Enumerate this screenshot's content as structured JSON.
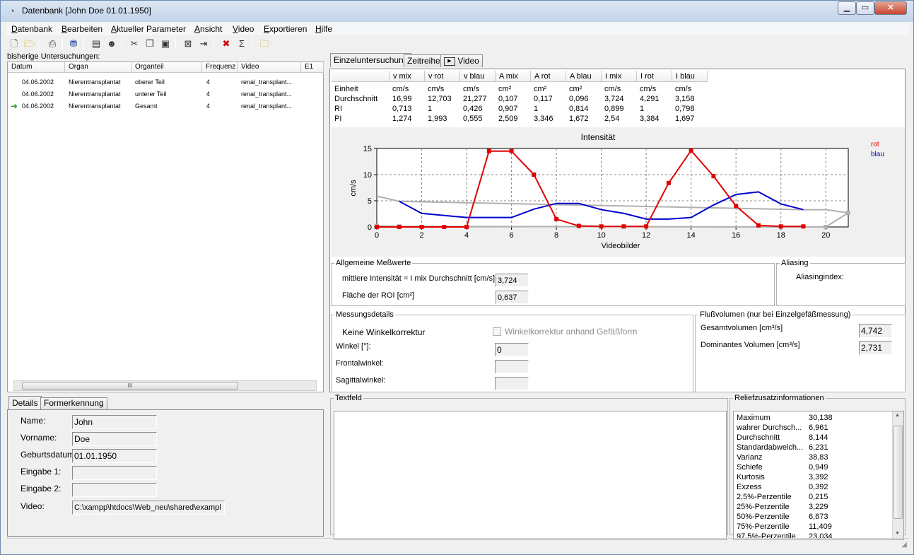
{
  "window": {
    "title": "Datenbank [John Doe 01.01.1950]",
    "min_glyph": "▁",
    "max_glyph": "▭",
    "close_glyph": "✕"
  },
  "menubar": {
    "items": [
      {
        "first": "D",
        "rest": "atenbank"
      },
      {
        "first": "B",
        "rest": "earbeiten"
      },
      {
        "first": "A",
        "rest": "ktueller Parameter"
      },
      {
        "first": "A",
        "rest": "nsicht"
      },
      {
        "first": "V",
        "rest": "ideo"
      },
      {
        "first": "E",
        "rest": "xportieren"
      },
      {
        "first": "H",
        "rest": "ilfe"
      }
    ]
  },
  "toolbar": {
    "icons": [
      "new-file-icon",
      "open-folder-icon",
      "print-icon",
      "filter-icon",
      "book-icon",
      "user-icon",
      "cut-icon",
      "copy-icon",
      "paste-icon",
      "box-icon",
      "exit-icon",
      "delete-icon",
      "sum-icon",
      "folder-icon"
    ]
  },
  "left": {
    "label": "bisherige Untersuchungen:",
    "columns": [
      "Datum",
      "Organ",
      "Organteil",
      "Frequenz",
      "Video",
      "E1"
    ],
    "rows": [
      {
        "datum": "04.06.2002",
        "organ": "Nierentransplantat",
        "organteil": "oberer Teil",
        "frequenz": "4",
        "video": "renal_transplant...",
        "marker": ""
      },
      {
        "datum": "04.06.2002",
        "organ": "Nierentransplantat",
        "organteil": "unterer Teil",
        "frequenz": "4",
        "video": "renal_transplant...",
        "marker": ""
      },
      {
        "datum": "04.06.2002",
        "organ": "Nierentransplantat",
        "organteil": "Gesamt",
        "frequenz": "4",
        "video": "renal_transplant...",
        "marker": "➜"
      }
    ],
    "scroll_grip": "III"
  },
  "details": {
    "tabs": [
      "Details",
      "Formerkennung"
    ],
    "fields": [
      {
        "label": "Name:",
        "value": "John"
      },
      {
        "label": "Vorname:",
        "value": "Doe"
      },
      {
        "label": "Geburtsdatum:",
        "value": "01.01.1950"
      },
      {
        "label": "Eingabe 1:",
        "value": ""
      },
      {
        "label": "Eingabe 2:",
        "value": ""
      },
      {
        "label": "Video:",
        "value": "C:\\xampp\\htdocs\\Web_neu\\shared\\exampl"
      }
    ]
  },
  "right_tabs": [
    "Einzeluntersuchung",
    "Zeitreihe",
    "Video"
  ],
  "stats": {
    "columns": [
      "",
      "v mix",
      "v rot",
      "v blau",
      "A mix",
      "A rot",
      "A blau",
      "I mix",
      "I rot",
      "I blau"
    ],
    "rows": [
      [
        "Einheit",
        "cm/s",
        "cm/s",
        "cm/s",
        "cm²",
        "cm²",
        "cm²",
        "cm/s",
        "cm/s",
        "cm/s"
      ],
      [
        "Durchschnitt",
        "16,99",
        "12,703",
        "21,277",
        "0,107",
        "0,117",
        "0,096",
        "3,724",
        "4,291",
        "3,158"
      ],
      [
        "RI",
        "0,713",
        "1",
        "0,426",
        "0,907",
        "1",
        "0,814",
        "0,899",
        "1",
        "0,798"
      ],
      [
        "PI",
        "1,274",
        "1,993",
        "0,555",
        "2,509",
        "3,346",
        "1,672",
        "2,54",
        "3,384",
        "1,697"
      ]
    ]
  },
  "chart_data": {
    "type": "line",
    "title": "Intensität",
    "xlabel": "Videobilder",
    "ylabel": "cm/s",
    "xlim": [
      0,
      21
    ],
    "ylim": [
      0,
      15
    ],
    "xticks": [
      0,
      2,
      4,
      6,
      8,
      10,
      12,
      14,
      16,
      18,
      20
    ],
    "yticks": [
      0,
      5,
      10,
      15
    ],
    "grid": true,
    "legend_position": "top-right",
    "series": [
      {
        "name": "rot",
        "color": "#e00000",
        "markers": true,
        "x": [
          0,
          1,
          2,
          3,
          4,
          5,
          6,
          7,
          8,
          9,
          10,
          11,
          12,
          13,
          14,
          15,
          16,
          17,
          18,
          19
        ],
        "y": [
          0,
          0,
          0,
          0,
          0,
          14.5,
          14.5,
          10,
          1.5,
          0.2,
          0.1,
          0.1,
          0.1,
          8.4,
          14.6,
          9.7,
          4,
          0.3,
          0.1,
          0.1
        ]
      },
      {
        "name": "blau",
        "color": "#0000d0",
        "markers": false,
        "x": [
          1,
          2,
          3,
          4,
          5,
          6,
          7,
          8,
          9,
          10,
          11,
          12,
          13,
          14,
          15,
          16,
          17,
          18,
          19
        ],
        "y": [
          4.9,
          2.6,
          2.2,
          1.8,
          1.8,
          1.8,
          3.4,
          4.5,
          4.5,
          3.3,
          2.6,
          1.5,
          1.5,
          1.8,
          4.2,
          6.2,
          6.7,
          4.4,
          3.3
        ]
      },
      {
        "color": "#b0b0b0",
        "markers": false,
        "x": [
          0,
          1,
          19,
          20,
          21
        ],
        "y": [
          5.9,
          4.9,
          3.3,
          3.3,
          2.7
        ]
      },
      {
        "color": "#b0b0b0",
        "markers": true,
        "x": [
          0,
          1,
          20,
          21
        ],
        "y": [
          0.2,
          0.1,
          0,
          2.7
        ]
      }
    ]
  },
  "allgemein": {
    "legend": "Allgemeine Meßwerte",
    "label1": "mittlere Intensität = I mix Durchschnitt [cm/s]:",
    "value1": "3,724",
    "label2": "Fläche der ROI [cm²]",
    "value2": "0,637"
  },
  "aliasing": {
    "legend": "Aliasing",
    "label": "Aliasingindex:"
  },
  "messung": {
    "legend": "Messungsdetails",
    "keine": "Keine Winkelkorrektur",
    "checkbox_label": "Winkelkorrektur anhand Gefäßform",
    "winkel_label": "Winkel [°]:",
    "winkel_value": "0",
    "frontal_label": "Frontalwinkel:",
    "sagittal_label": "Sagittalwinkel:"
  },
  "fluss": {
    "legend": "Flußvolumen (nur bei Einzelgefäßmessung)",
    "gesamt_label": "Gesamtvolumen [cm³/s]",
    "gesamt_value": "4,742",
    "dominant_label": "Dominantes Volumen [cm³/s]",
    "dominant_value": "2,731"
  },
  "textfeld": {
    "legend": "Textfeld"
  },
  "relief": {
    "legend": "Reliefzusatzinformationen",
    "rows": [
      [
        "Maximum",
        "30,138"
      ],
      [
        "wahrer Durchsch...",
        "6,961"
      ],
      [
        "Durchschnitt",
        "8,144"
      ],
      [
        "Standardabweich...",
        "6,231"
      ],
      [
        "Varianz",
        "38,83"
      ],
      [
        "Schiefe",
        "0,949"
      ],
      [
        "Kurtosis",
        "3,392"
      ],
      [
        "Exzess",
        "0,392"
      ],
      [
        "2,5%-Perzentile",
        "0,215"
      ],
      [
        "25%-Perzentile",
        "3,229"
      ],
      [
        "50%-Perzentile",
        "6,673"
      ],
      [
        "75%-Perzentile",
        "11,409"
      ],
      [
        "97,5%-Perzentile",
        "23,034"
      ]
    ]
  }
}
